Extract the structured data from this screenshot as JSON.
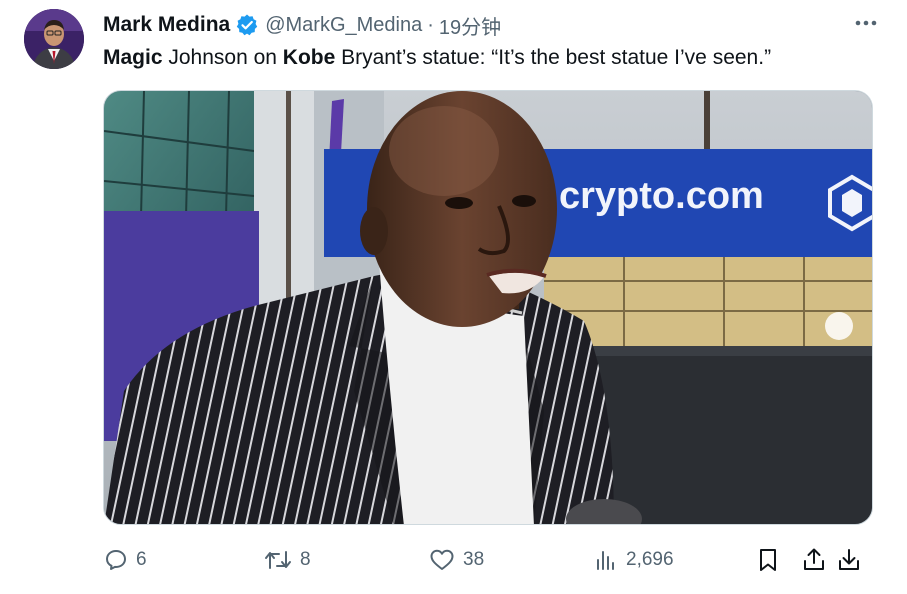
{
  "author": {
    "display_name": "Mark Medina",
    "handle": "@MarkG_Medina",
    "separator": "·",
    "time": "19分钟",
    "verified": true,
    "avatar_icon": "profile-photo"
  },
  "tweet": {
    "segments": [
      {
        "text": "Magic",
        "bold": true
      },
      {
        "text": " Johnson on ",
        "bold": false
      },
      {
        "text": "Kobe",
        "bold": true
      },
      {
        "text": " Bryant’s statue: “It’s the best statue I’ve seen.”",
        "bold": false
      }
    ]
  },
  "media": {
    "sign_text": "crypto.com",
    "description_icon": "video-thumbnail"
  },
  "actions": {
    "replies": "6",
    "retweets": "8",
    "likes": "38",
    "views": "2,696"
  },
  "colors": {
    "text": "#0f1419",
    "secondary": "#536471",
    "verified": "#1d9bf0",
    "sign_blue": "#1a3fa8"
  },
  "icons": {
    "more": "more-dots-icon",
    "reply": "reply-icon",
    "retweet": "retweet-icon",
    "like": "heart-icon",
    "views": "views-icon",
    "bookmark": "bookmark-icon",
    "share": "share-icon",
    "download": "download-icon"
  }
}
